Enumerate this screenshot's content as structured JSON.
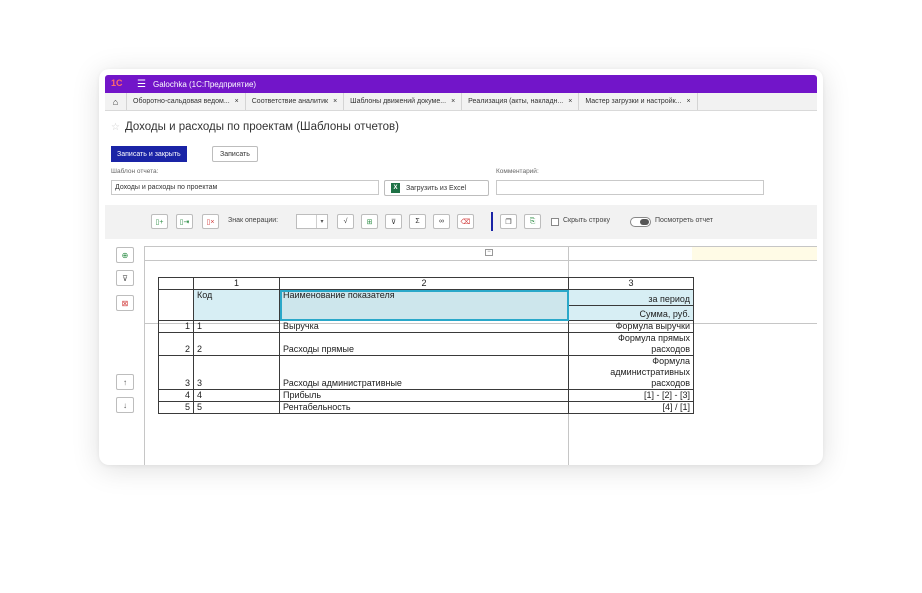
{
  "app": {
    "logo_text": "1С",
    "title": "Galochka  (1С:Предприятие)"
  },
  "tabs": [
    {
      "label": "Оборотно-сальдовая ведом...",
      "close": "×"
    },
    {
      "label": "Соответствие аналитик",
      "close": "×"
    },
    {
      "label": "Шаблоны движений докуме...",
      "close": "×"
    },
    {
      "label": "Реализация (акты, накладн...",
      "close": "×"
    },
    {
      "label": "Мастер загрузки и настройк...",
      "close": "×"
    }
  ],
  "page": {
    "title": "Доходы и расходы по проектам (Шаблоны отчетов)"
  },
  "actions": {
    "save_close": "Записать и закрыть",
    "save": "Записать"
  },
  "form": {
    "template_label": "Шаблон отчета:",
    "template_value": "Доходы и расходы по проектам",
    "excel_button": "Загрузить из Excel",
    "comment_label": "Комментарий:",
    "comment_value": ""
  },
  "toolbar": {
    "op_label": "Знак операции:",
    "op_value": "",
    "hide_row": "Скрыть строку",
    "view_report": "Посмотреть отчет"
  },
  "table": {
    "col_numbers": [
      "1",
      "2",
      "3"
    ],
    "header": {
      "code": "Код",
      "name": "Наименование показателя",
      "period": "за период",
      "sum": "Сумма, руб."
    },
    "rows": [
      {
        "n": "1",
        "code": "1",
        "name": "Выручка",
        "formula_lines": [
          "Формула выручки"
        ]
      },
      {
        "n": "2",
        "code": "2",
        "name": "Расходы прямые",
        "formula_lines": [
          "Формула прямых",
          "расходов"
        ]
      },
      {
        "n": "3",
        "code": "3",
        "name": "Расходы административные",
        "formula_lines": [
          "Формула",
          "административных",
          "расходов"
        ]
      },
      {
        "n": "4",
        "code": "4",
        "name": "Прибыль",
        "formula_lines": [
          "[1] - [2] - [3]"
        ]
      },
      {
        "n": "5",
        "code": "5",
        "name": "Рентабельность",
        "formula_lines": [
          "[4] / [1]"
        ]
      }
    ]
  },
  "colors": {
    "titlebar": "#7215c9",
    "primary_button": "#1a24a6",
    "selection": "#2aa8c9",
    "header_fill": "#d7eef4"
  }
}
